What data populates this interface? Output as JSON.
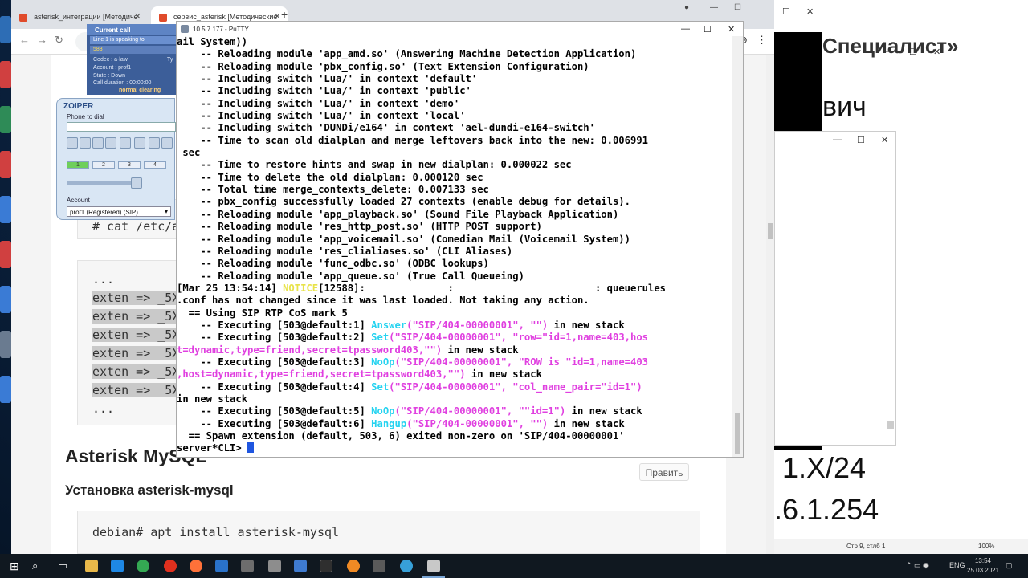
{
  "browser": {
    "tabs": [
      {
        "label": "asterisk_интеграции [Методиче"
      },
      {
        "label": "сервис_asterisk [Методические"
      }
    ],
    "new_tab": "+"
  },
  "page": {
    "code_block_1": {
      "lines": [
        "...",
        "exten => _5X",
        "exten => _5X",
        "exten => _5X",
        "exten => _5X",
        "exten => _5X",
        "exten => _5X",
        "..."
      ]
    },
    "cat_line": "# cat /etc/a",
    "heading": "Asterisk MySQL",
    "subheading": "Установка asterisk-mysql",
    "edit_button": "Править",
    "install_cmd": "debian# apt install asterisk-mysql"
  },
  "right_window": {
    "title_fragment": "Специалист»",
    "name_fragment": "вич",
    "net_line_1": "1.X/24",
    "net_line_2": ".6.1.254",
    "status_line_col": "Стр 9, стлб 1",
    "status_zoom": "100%"
  },
  "call_panel": {
    "header": "Current call",
    "line_status": "Line 1 is speaking to",
    "number": "583",
    "codec": "Codec : a-law",
    "codec_right": "Ty",
    "account": "Account : prof1",
    "state": "State : Down",
    "duration": "Call duration : 00:00:00",
    "clearing": "normal clearing"
  },
  "zoiper": {
    "logo": "ZOIPER",
    "phone_label": "Phone to dial",
    "lines": [
      "1",
      "2",
      "3",
      "4"
    ],
    "account_label": "Account",
    "account_value": "prof1 (Registered) (SIP)"
  },
  "putty": {
    "title": "10.5.7.177 - PuTTY",
    "lines": [
      "ail System))",
      "    -- Reloading module 'app_amd.so' (Answering Machine Detection Application)",
      "    -- Reloading module 'pbx_config.so' (Text Extension Configuration)",
      "    -- Including switch 'Lua/' in context 'default'",
      "    -- Including switch 'Lua/' in context 'public'",
      "    -- Including switch 'Lua/' in context 'demo'",
      "    -- Including switch 'Lua/' in context 'local'",
      "    -- Including switch 'DUNDi/e164' in context 'ael-dundi-e164-switch'",
      "    -- Time to scan old dialplan and merge leftovers back into the new: 0.006991",
      " sec",
      "    -- Time to restore hints and swap in new dialplan: 0.000022 sec",
      "    -- Time to delete the old dialplan: 0.000120 sec",
      "    -- Total time merge_contexts_delete: 0.007133 sec",
      "    -- pbx_config successfully loaded 27 contexts (enable debug for details).",
      "    -- Reloading module 'app_playback.so' (Sound File Playback Application)",
      "    -- Reloading module 'res_http_post.so' (HTTP POST support)",
      "    -- Reloading module 'app_voicemail.so' (Comedian Mail (Voicemail System))",
      "    -- Reloading module 'res_clialiases.so' (CLI Aliases)",
      "    -- Reloading module 'func_odbc.so' (ODBC lookups)",
      "    -- Reloading module 'app_queue.so' (True Call Queueing)"
    ],
    "notice_line": {
      "pre": "[Mar 25 13:54:14] ",
      "tag": "NOTICE",
      "post": "[12588]:              :                        : queuerules"
    },
    "notice_cont": ".conf has not changed since it was last loaded. Not taking any action.",
    "cos_line": "  == Using SIP RTP CoS mark 5",
    "exec": [
      {
        "pre": "    -- Executing [503@default:1] ",
        "app": "Answer",
        "args": "(\"SIP/404-00000001\", \"\")",
        "post": " in new stack"
      },
      {
        "pre": "    -- Executing [503@default:2] ",
        "app": "Set",
        "args": "(\"SIP/404-00000001\", \"row=\"id=1,name=403,hos",
        "post": ""
      },
      {
        "pre": "",
        "app": "",
        "args": "t=dynamic,type=friend,secret=tpassword403,\"\")",
        "post": " in new stack"
      },
      {
        "pre": "    -- Executing [503@default:3] ",
        "app": "NoOp",
        "args": "(\"SIP/404-00000001\", \"ROW is \"id=1,name=403",
        "post": ""
      },
      {
        "pre": "",
        "app": "",
        "args": ",host=dynamic,type=friend,secret=tpassword403,\"\")",
        "post": " in new stack"
      },
      {
        "pre": "    -- Executing [503@default:4] ",
        "app": "Set",
        "args": "(\"SIP/404-00000001\", \"col_name_pair=\"id=1\")",
        "post": ""
      },
      {
        "pre": "",
        "app": "",
        "args": "",
        "post": "in new stack"
      },
      {
        "pre": "    -- Executing [503@default:5] ",
        "app": "NoOp",
        "args": "(\"SIP/404-00000001\", \"\"id=1\")",
        "post": " in new stack"
      },
      {
        "pre": "    -- Executing [503@default:6] ",
        "app": "Hangup",
        "args": "(\"SIP/404-00000001\", \"\")",
        "post": " in new stack"
      }
    ],
    "spawn_line": "  == Spawn extension (default, 503, 6) exited non-zero on 'SIP/404-00000001'",
    "prompt": "server*CLI> ",
    "colors": {
      "notice": "#e8e34a",
      "app": "#25d3f0",
      "arg": "#e040e0"
    }
  },
  "taskbar": {
    "lang": "ENG",
    "time": "13:54",
    "date": "25.03.2021"
  }
}
